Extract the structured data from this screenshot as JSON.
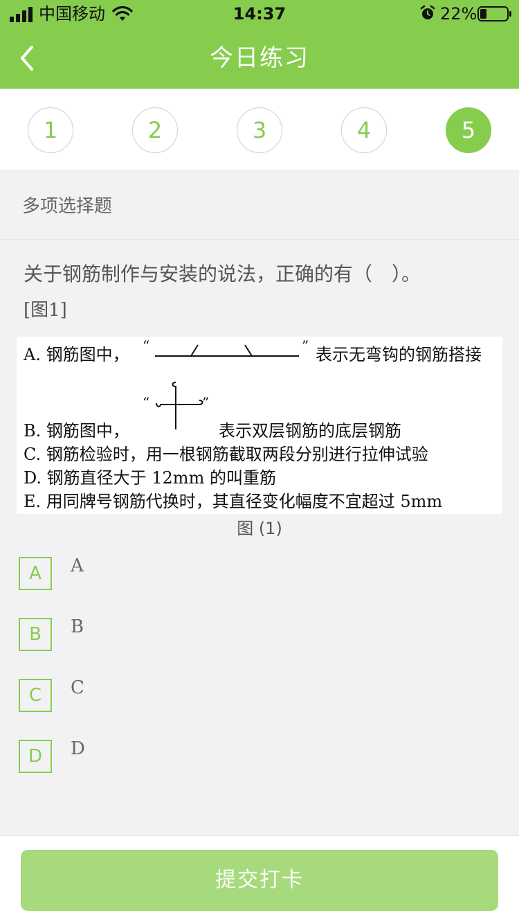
{
  "status_bar": {
    "carrier": "中国移动",
    "time": "14:37",
    "battery_percent": "22%"
  },
  "nav": {
    "title": "今日练习",
    "back_icon": "chevron-left-icon"
  },
  "question_index": {
    "items": [
      "1",
      "2",
      "3",
      "4",
      "5"
    ],
    "active": "5"
  },
  "question": {
    "type_label": "多项选择题",
    "stem": "关于钢筋制作与安装的说法，正确的有（　）。",
    "figure_ref": "[图1]",
    "figure_lines": {
      "a_prefix": "A. 钢筋图中，",
      "a_suffix": "表示无弯钩的钢筋搭接",
      "b_prefix": "B. 钢筋图中，",
      "b_suffix": "表示双层钢筋的底层钢筋",
      "c": "C. 钢筋检验时，用一根钢筋截取两段分别进行拉伸试验",
      "d": "D. 钢筋直径大于 12mm 的叫重筋",
      "e": "E. 用同牌号钢筋代换时，其直径变化幅度不宜超过 5mm"
    },
    "figure_caption": "图 (1)"
  },
  "options": [
    {
      "key": "A",
      "text": "A"
    },
    {
      "key": "B",
      "text": "B"
    },
    {
      "key": "C",
      "text": "C"
    },
    {
      "key": "D",
      "text": "D"
    }
  ],
  "footer": {
    "submit_label": "提交打卡"
  },
  "colors": {
    "accent": "#86cd4e",
    "accent_disabled": "#a6da7c",
    "background": "#f2f2f4"
  }
}
